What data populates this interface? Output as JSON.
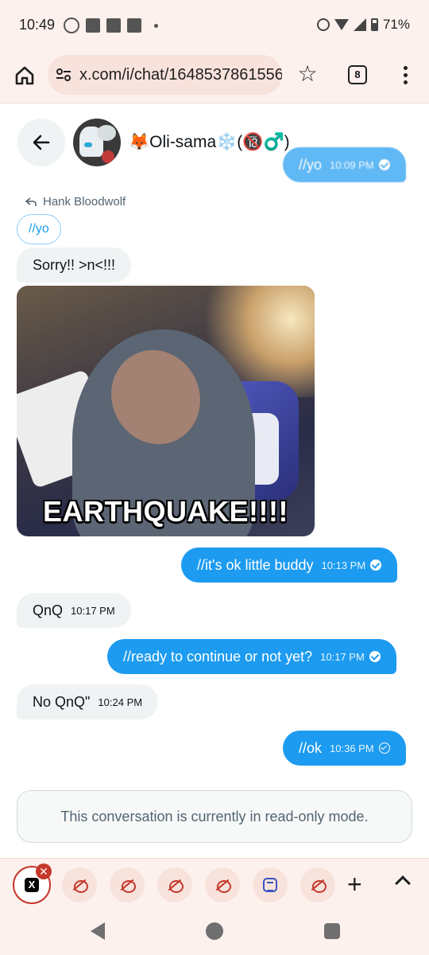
{
  "status_bar": {
    "time": "10:49",
    "battery": "71%"
  },
  "browser": {
    "url": "x.com/i/chat/1648537861556",
    "tab_count": "8"
  },
  "chat": {
    "contact_name": "🦊Oli-sama❄️(🔞♂️)",
    "messages": [
      {
        "id": "m0",
        "direction": "out",
        "text": "//yo",
        "time": "10:09 PM",
        "status": "read"
      },
      {
        "id": "m1",
        "direction": "in",
        "reply_to_label": "Hank Bloodwolf",
        "reply_to_text": "//yo",
        "text": "Sorry!! >n<!!!"
      },
      {
        "id": "m2",
        "direction": "in",
        "type": "gif",
        "caption": "EARTHQUAKE!!!!"
      },
      {
        "id": "m3",
        "direction": "out",
        "text": "//it's ok little buddy",
        "time": "10:13 PM",
        "status": "read"
      },
      {
        "id": "m4",
        "direction": "in",
        "text": "QnQ",
        "time": "10:17 PM"
      },
      {
        "id": "m5",
        "direction": "out",
        "text": "//ready to continue or not yet?",
        "time": "10:17 PM",
        "status": "read"
      },
      {
        "id": "m6",
        "direction": "in",
        "text": "No QnQ\"",
        "time": "10:24 PM"
      },
      {
        "id": "m7",
        "direction": "out",
        "text": "//ok",
        "time": "10:36 PM",
        "status": "sent"
      }
    ],
    "readonly_notice": "This conversation is currently in read-only mode."
  },
  "tab_strip": {
    "tabs": [
      {
        "icon": "x-logo-icon",
        "active": true
      },
      {
        "icon": "reddit-icon"
      },
      {
        "icon": "reddit-icon"
      },
      {
        "icon": "reddit-icon"
      },
      {
        "icon": "reddit-icon"
      },
      {
        "icon": "e-app-icon"
      },
      {
        "icon": "reddit-icon"
      }
    ],
    "new_tab": "+"
  },
  "colors": {
    "accent": "#1d9bf0",
    "incoming_bg": "#eff3f4",
    "browser_bg": "#fdf1ee",
    "tab_close": "#c5382b"
  }
}
